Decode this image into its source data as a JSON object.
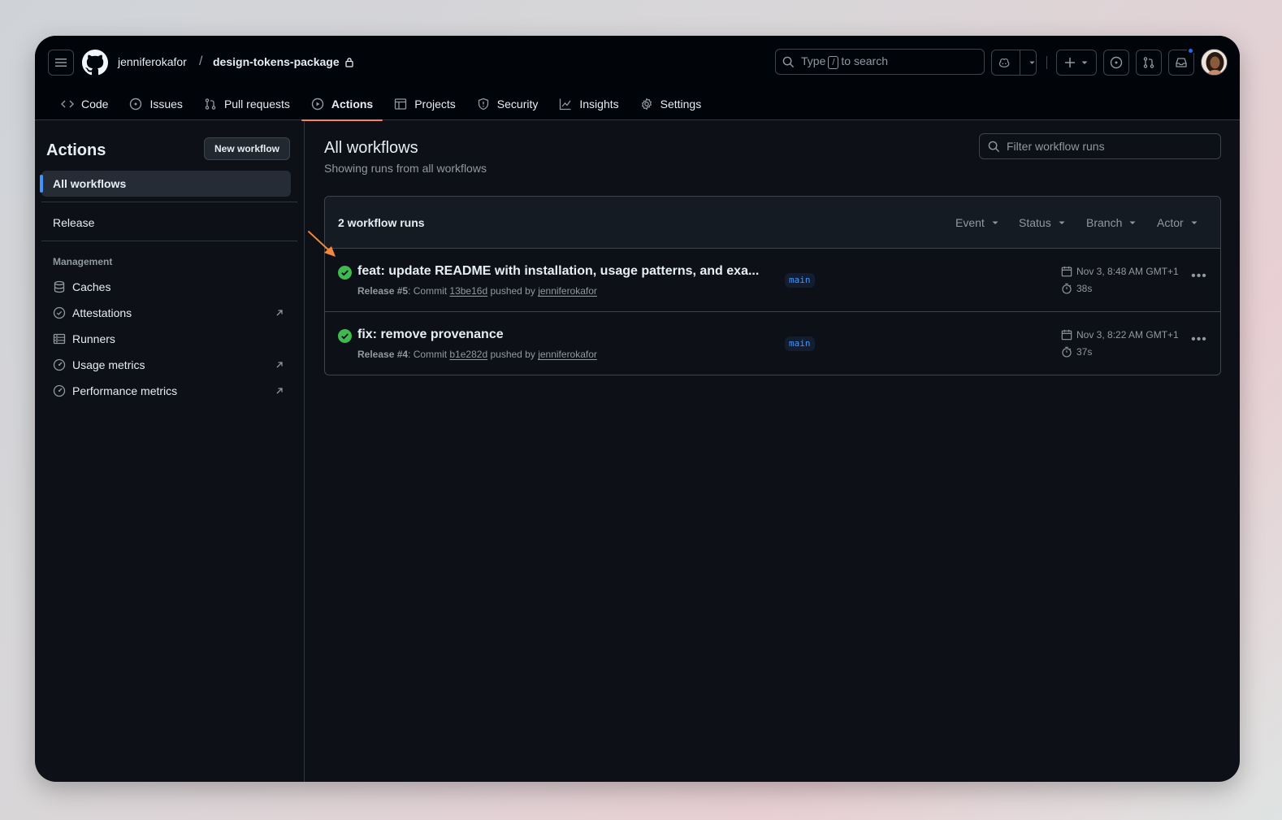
{
  "header": {
    "owner": "jenniferokafor",
    "separator": "/",
    "repo": "design-tokens-package",
    "search": {
      "prefix": "Type",
      "key": "/",
      "suffix": "to search"
    }
  },
  "tabs": [
    {
      "label": "Code",
      "icon": "code-icon"
    },
    {
      "label": "Issues",
      "icon": "issue-opened-icon"
    },
    {
      "label": "Pull requests",
      "icon": "git-pull-request-icon"
    },
    {
      "label": "Actions",
      "icon": "play-icon",
      "active": true
    },
    {
      "label": "Projects",
      "icon": "table-icon"
    },
    {
      "label": "Security",
      "icon": "shield-icon"
    },
    {
      "label": "Insights",
      "icon": "graph-icon"
    },
    {
      "label": "Settings",
      "icon": "gear-icon"
    }
  ],
  "sidebar": {
    "title": "Actions",
    "new_workflow": "New workflow",
    "all_workflows": "All workflows",
    "release": "Release",
    "management_heading": "Management",
    "management": [
      {
        "label": "Caches",
        "icon": "database-icon"
      },
      {
        "label": "Attestations",
        "icon": "verified-icon",
        "external": true
      },
      {
        "label": "Runners",
        "icon": "server-icon"
      },
      {
        "label": "Usage metrics",
        "icon": "meter-icon",
        "external": true
      },
      {
        "label": "Performance metrics",
        "icon": "meter-icon",
        "external": true
      }
    ]
  },
  "main": {
    "title": "All workflows",
    "subtitle": "Showing runs from all workflows",
    "filter_placeholder": "Filter workflow runs",
    "runs_count": "2 workflow runs",
    "filters": [
      "Event",
      "Status",
      "Branch",
      "Actor"
    ],
    "runs": [
      {
        "title": "feat: update README with installation, usage patterns, and exa...",
        "workflow": "Release #5",
        "commit_prefix": ": Commit",
        "commit": "13be16d",
        "pushed_by": "pushed by",
        "author": "jenniferokafor",
        "branch": "main",
        "date": "Nov 3, 8:48 AM GMT+1",
        "duration": "38s",
        "status": "success"
      },
      {
        "title": "fix: remove provenance",
        "workflow": "Release #4",
        "commit_prefix": ": Commit",
        "commit": "b1e282d",
        "pushed_by": "pushed by",
        "author": "jenniferokafor",
        "branch": "main",
        "date": "Nov 3, 8:22 AM GMT+1",
        "duration": "37s",
        "status": "success"
      }
    ]
  },
  "colors": {
    "background": "#0d1117",
    "header": "#010409",
    "accent_underline": "#f78166",
    "success": "#3fb950",
    "link": "#4493f8",
    "annotation_arrow": "#f0883e"
  }
}
